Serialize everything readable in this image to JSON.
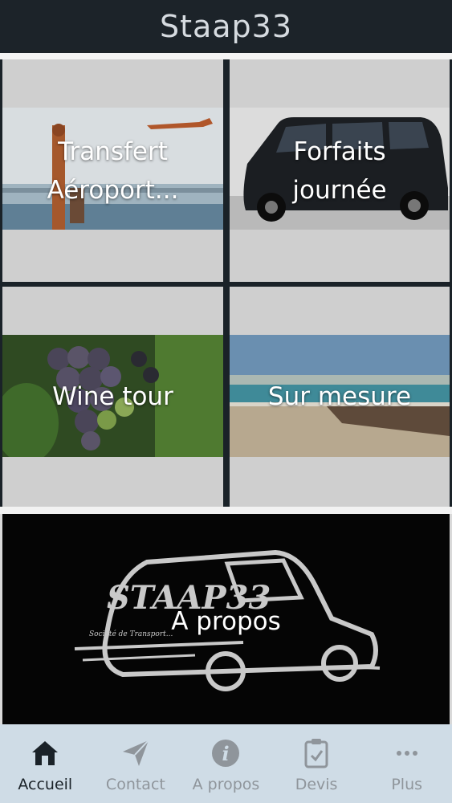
{
  "header": {
    "title": "Staap33"
  },
  "tiles": [
    {
      "label": "Transfert Aéroport..."
    },
    {
      "label": "Forfaits journée"
    },
    {
      "label": "Wine tour"
    },
    {
      "label": "Sur mesure"
    }
  ],
  "about_banner": {
    "label": "A propos",
    "logo_text": "STAAP33",
    "logo_subtext": "Société de Transport..."
  },
  "tabbar": {
    "items": [
      {
        "label": "Accueil",
        "icon": "home-icon",
        "active": true
      },
      {
        "label": "Contact",
        "icon": "paper-plane-icon",
        "active": false
      },
      {
        "label": "A propos",
        "icon": "info-icon",
        "active": false
      },
      {
        "label": "Devis",
        "icon": "clipboard-icon",
        "active": false
      },
      {
        "label": "Plus",
        "icon": "more-icon",
        "active": false
      }
    ]
  },
  "colors": {
    "header_bg": "#1c2329",
    "tabbar_bg": "#cfdce6",
    "active_tab": "#1a2228",
    "inactive_tab": "#8f959b"
  }
}
